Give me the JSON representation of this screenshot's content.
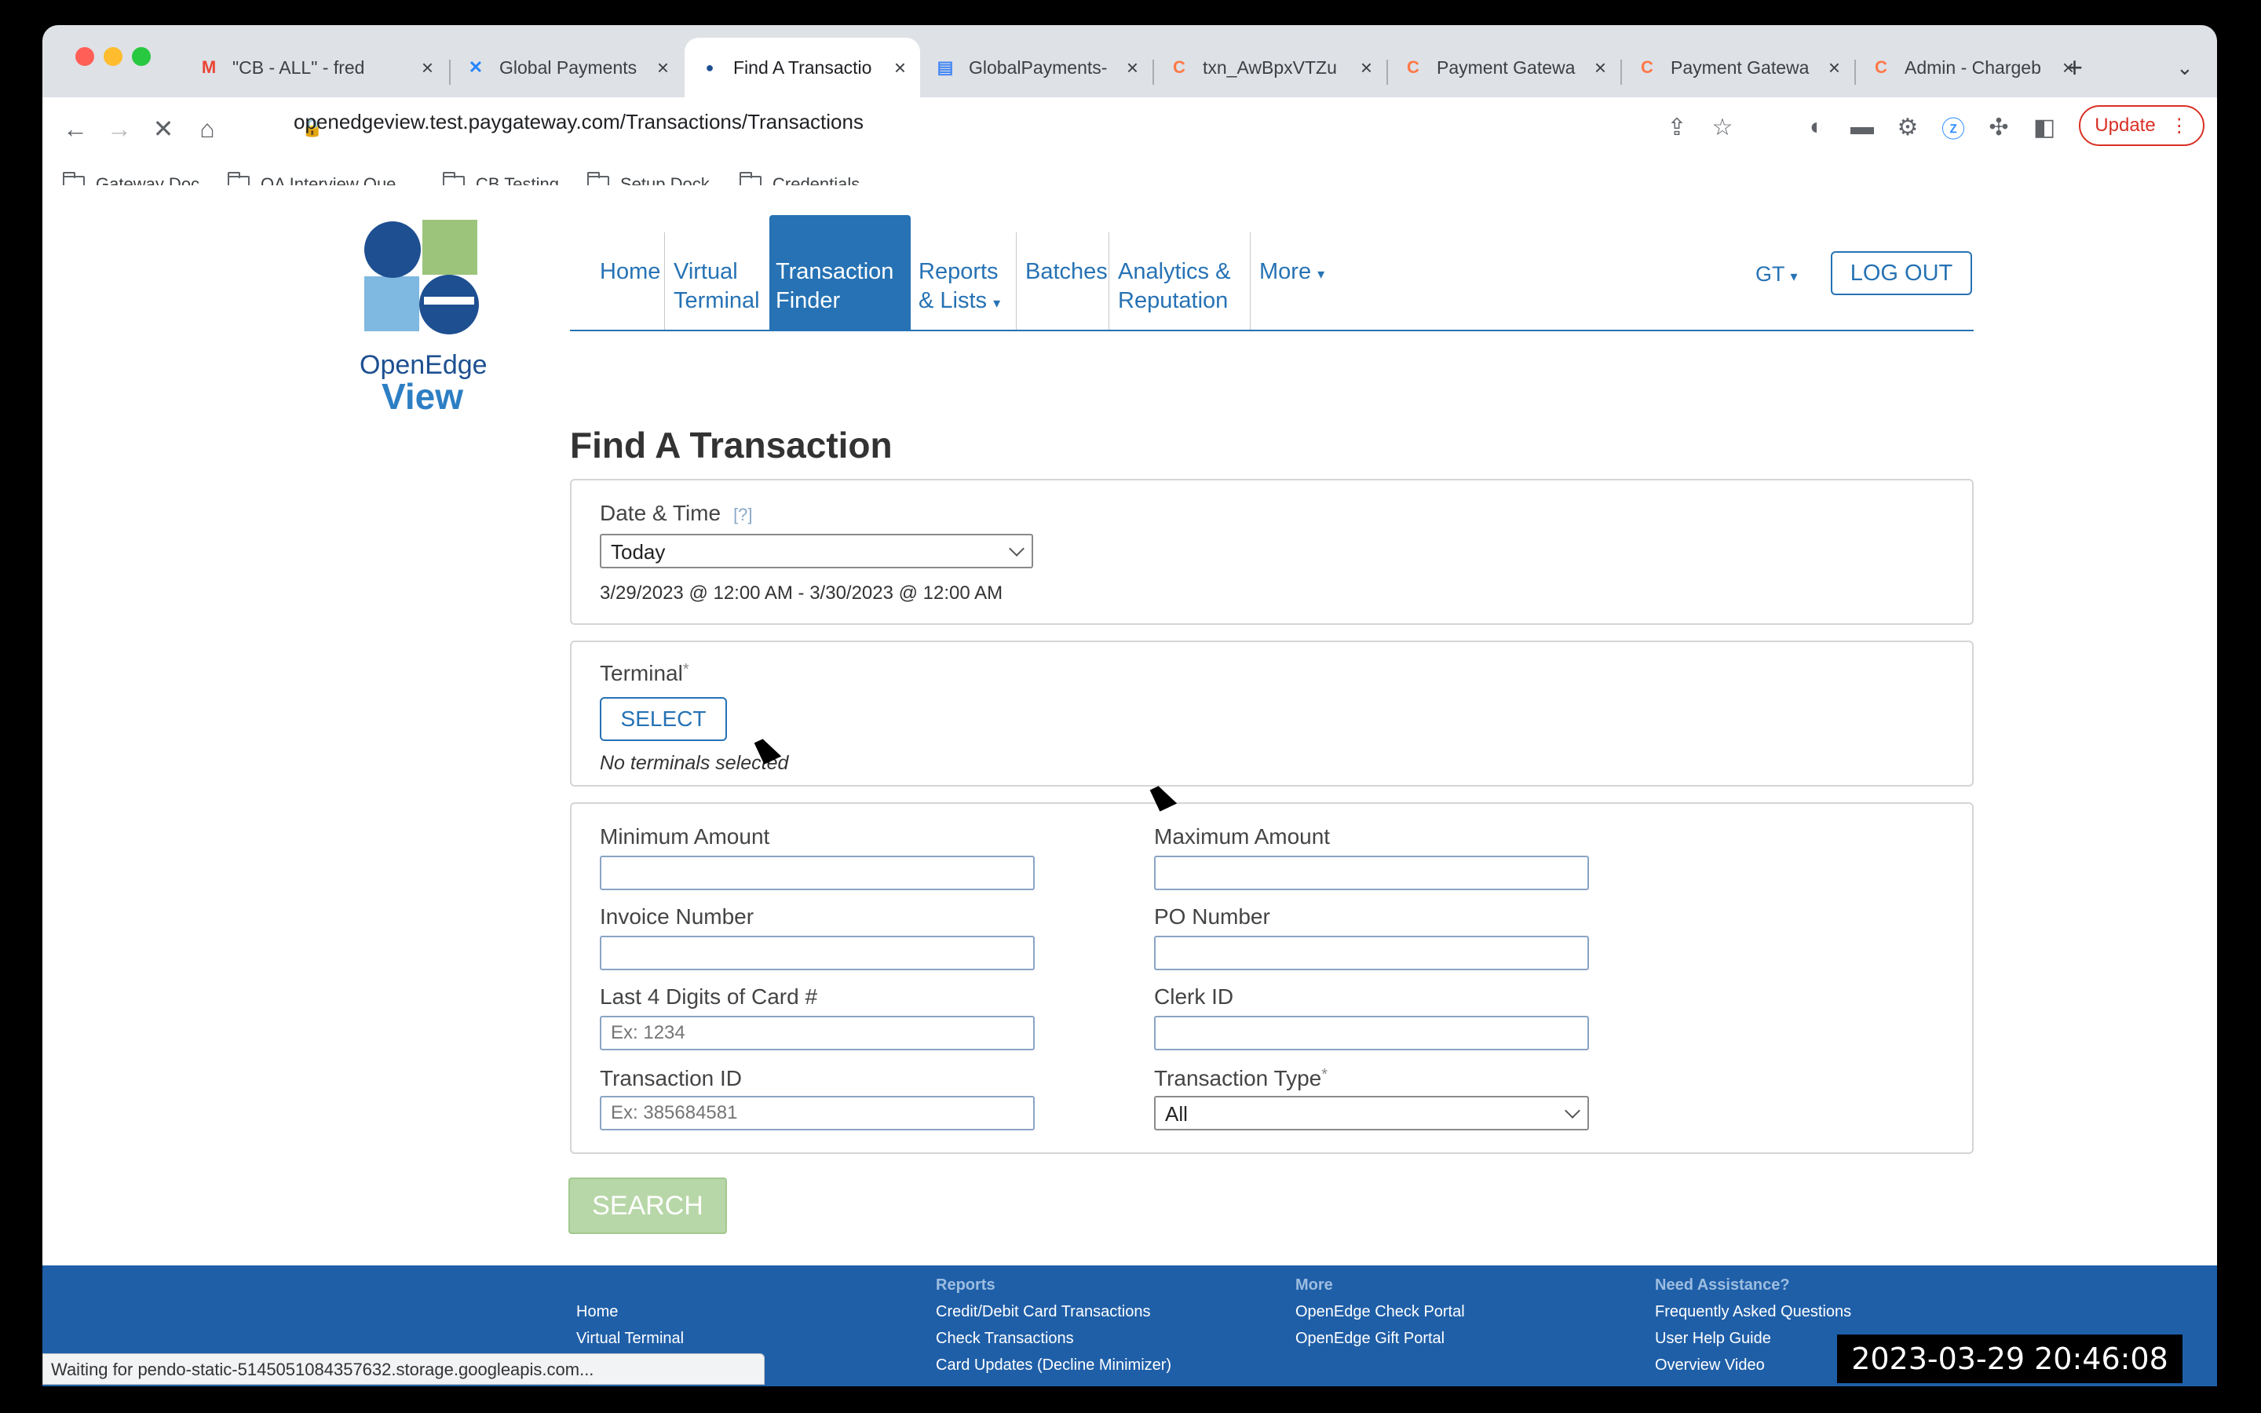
{
  "browser": {
    "tabs": [
      {
        "label": "\"CB - ALL\" - fred",
        "icon": "gmail-icon",
        "color": "#ea4335"
      },
      {
        "label": "Global Payments",
        "icon": "confluence-icon",
        "color": "#2684ff"
      },
      {
        "label": "Find A Transactio",
        "icon": "openedge-icon",
        "color": "#1d4f91"
      },
      {
        "label": "GlobalPayments-",
        "icon": "google-docs-icon",
        "color": "#4285f4"
      },
      {
        "label": "txn_AwBpxVTZu",
        "icon": "chargebee-icon",
        "color": "#ff7846"
      },
      {
        "label": "Payment Gatewa",
        "icon": "chargebee-icon",
        "color": "#ff7846"
      },
      {
        "label": "Payment Gatewa",
        "icon": "chargebee-icon",
        "color": "#ff7846"
      },
      {
        "label": "Admin - Chargeb",
        "icon": "chargebee-icon",
        "color": "#ff7846"
      }
    ],
    "url": "openedgeview.test.paygateway.com/Transactions/Transactions",
    "update_label": "Update",
    "bookmarks": [
      "Gateway Doc",
      "QA Interview Que...",
      "CB Testing",
      "Setup Dock",
      "Credentials"
    ],
    "status_text": "Waiting for pendo-static-5145051084357632.storage.googleapis.com..."
  },
  "logo": {
    "line1": "OpenEdge",
    "line2": "View"
  },
  "nav": {
    "home": "Home",
    "virtual_terminal_1": "Virtual",
    "virtual_terminal_2": "Terminal",
    "transaction_finder_1": "Transaction",
    "transaction_finder_2": "Finder",
    "reports_1": "Reports",
    "reports_2": "& Lists",
    "batches": "Batches",
    "analytics_1": "Analytics &",
    "analytics_2": "Reputation",
    "more": "More",
    "user": "GT",
    "logout": "LOG OUT"
  },
  "page_title": "Find A Transaction",
  "date_panel": {
    "label": "Date & Time",
    "help": "[?]",
    "selected": "Today",
    "range": "3/29/2023 @ 12:00 AM - 3/30/2023 @ 12:00 AM"
  },
  "terminal_panel": {
    "label": "Terminal",
    "required": "*",
    "button": "SELECT",
    "empty_text": "No terminals selected"
  },
  "filters": {
    "min_amount": {
      "label": "Minimum Amount",
      "placeholder": ""
    },
    "max_amount": {
      "label": "Maximum Amount",
      "placeholder": ""
    },
    "invoice": {
      "label": "Invoice Number",
      "placeholder": ""
    },
    "po": {
      "label": "PO Number",
      "placeholder": ""
    },
    "last4": {
      "label": "Last 4 Digits of Card #",
      "placeholder": "Ex: 1234"
    },
    "clerk": {
      "label": "Clerk ID",
      "placeholder": ""
    },
    "txn_id": {
      "label": "Transaction ID",
      "placeholder": "Ex: 385684581"
    },
    "txn_type": {
      "label": "Transaction Type",
      "required": "*",
      "selected": "All"
    }
  },
  "search_button": "SEARCH",
  "footer": {
    "col1": [
      "Home",
      "Virtual Terminal"
    ],
    "col2_head": "Reports",
    "col2": [
      "Credit/Debit Card Transactions",
      "Check Transactions",
      "Card Updates (Decline Minimizer)"
    ],
    "col3_head": "More",
    "col3": [
      "OpenEdge Check Portal",
      "OpenEdge Gift Portal"
    ],
    "col4_head": "Need Assistance?",
    "col4": [
      "Frequently Asked Questions",
      "User Help Guide",
      "Overview Video"
    ]
  },
  "timestamp": "2023-03-29  20:46:08",
  "colors": {
    "brand_blue": "#2672b4",
    "footer_blue": "#1f5fa8",
    "search_green": "#b8d7a8"
  }
}
